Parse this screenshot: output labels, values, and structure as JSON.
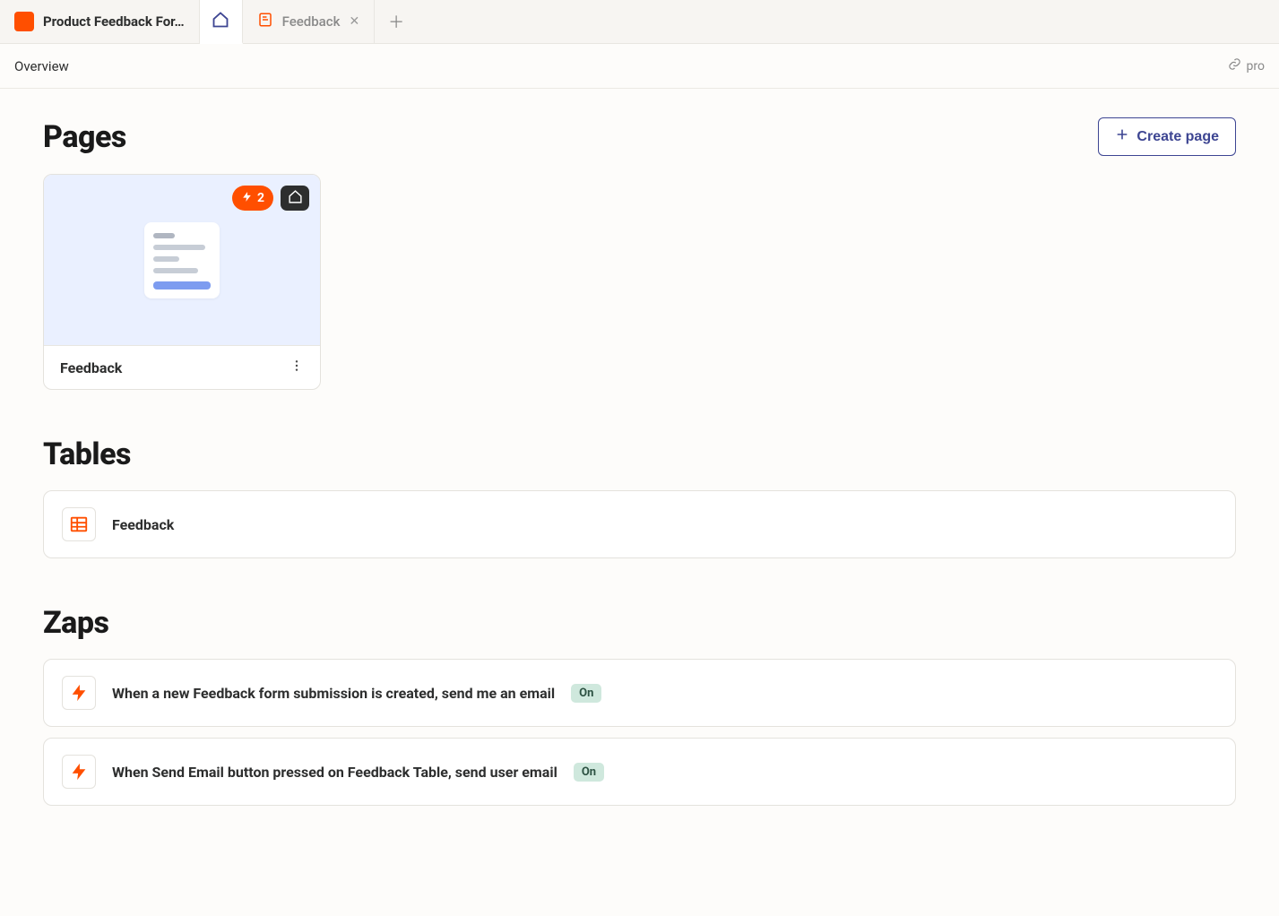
{
  "tabs": {
    "project_title": "Product Feedback For…",
    "feedback_tab": "Feedback"
  },
  "secondary": {
    "overview": "Overview",
    "link_text": "pro"
  },
  "pages": {
    "heading": "Pages",
    "create_button": "Create page",
    "card": {
      "badge_count": "2",
      "name": "Feedback"
    }
  },
  "tables": {
    "heading": "Tables",
    "items": [
      {
        "name": "Feedback"
      }
    ]
  },
  "zaps": {
    "heading": "Zaps",
    "items": [
      {
        "title": "When a new Feedback form submission is created, send me an email",
        "status": "On"
      },
      {
        "title": "When Send Email button pressed on Feedback Table, send user email",
        "status": "On"
      }
    ]
  }
}
